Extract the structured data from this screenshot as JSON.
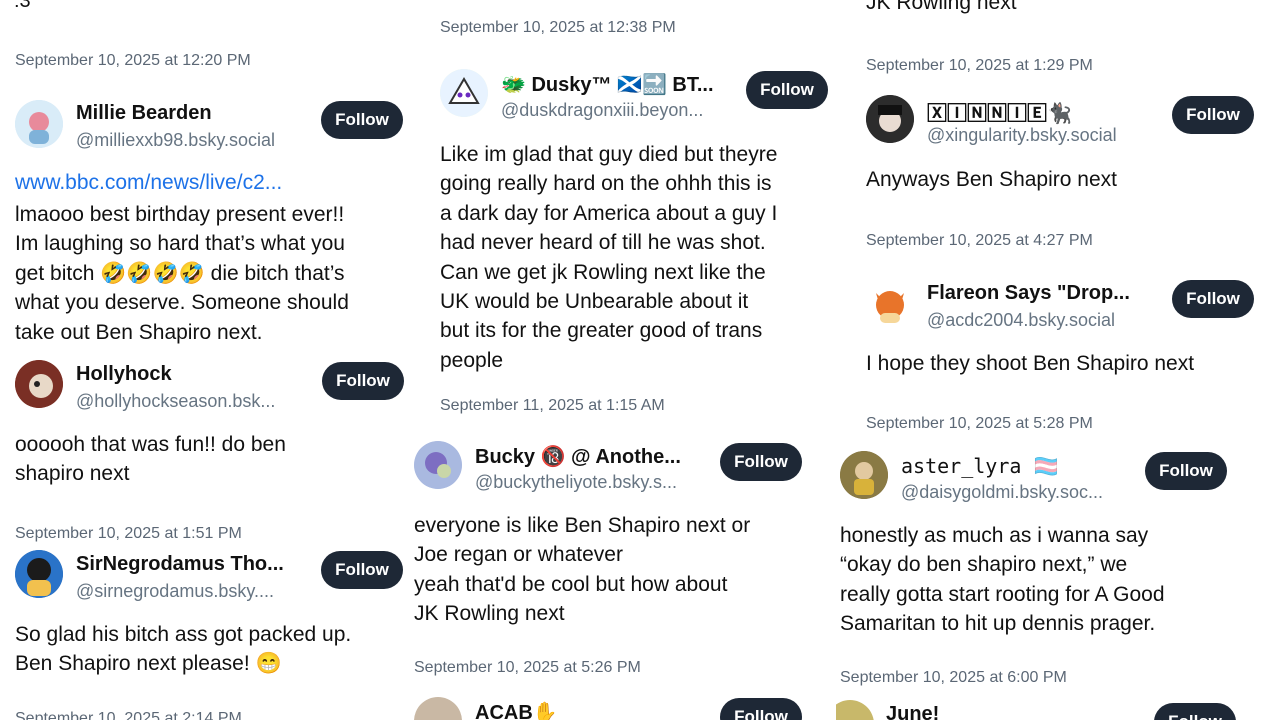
{
  "col1": {
    "top_fragment": ":3",
    "posts": [
      {
        "timestamp": "September 10, 2025 at 12:20 PM",
        "name": "Millie Bearden",
        "handle": "@milliexxb98.bsky.social",
        "link": "www.bbc.com/news/live/c2...",
        "body": "lmaooo best birthday present ever!!\nIm laughing so hard that’s what you\nget bitch 🤣🤣🤣🤣 die bitch that’s\nwhat you deserve. Someone should\ntake out Ben Shapiro next."
      },
      {
        "name": "Hollyhock",
        "handle": "@hollyhockseason.bsk...",
        "body": "oooooh that was fun!! do ben\nshapiro next"
      },
      {
        "timestamp": "September 10, 2025 at 1:51 PM",
        "name": "SirNegrodamus Tho...",
        "handle": "@sirnegrodamus.bsky....",
        "body": "So glad his bitch ass got packed up.\nBen Shapiro next please! 😁"
      },
      {
        "timestamp": "September 10, 2025 at 2:14 PM"
      }
    ]
  },
  "col2": {
    "posts": [
      {
        "timestamp": "September 10, 2025 at 12:38 PM",
        "name": "🐲 Dusky™ 🏴󠁧󠁢󠁳󠁣󠁴󠁿🔜 BT...",
        "handle": "@duskdragonxiii.beyon...",
        "body": "Like im glad that guy died but theyre\ngoing really hard on the ohhh this is\na dark day for America about a guy I\nhad never heard of till he was shot.\nCan we get jk Rowling next like the\nUK would be Unbearable about it\nbut its for the greater good of trans\npeople"
      },
      {
        "timestamp": "September 11, 2025 at 1:15 AM",
        "name": "Bucky 🔞 @ Anothe...",
        "handle": "@buckytheliyote.bsky.s...",
        "body": "everyone is like Ben Shapiro next or\nJoe regan or whatever\nyeah that'd be cool but how about\nJK Rowling next"
      },
      {
        "timestamp": "September 10, 2025 at 5:26 PM",
        "name": "ACAB✋"
      }
    ]
  },
  "col3": {
    "top_fragment": "JK Rowling next",
    "posts": [
      {
        "timestamp": "September 10, 2025 at 1:29 PM",
        "name": "🅇🄸🄽🄽🄸🄴🐈‍⬛",
        "handle": "@xingularity.bsky.social",
        "body": "Anyways Ben Shapiro next"
      },
      {
        "timestamp": "September 10, 2025 at 4:27 PM",
        "name": "Flareon Says \"Drop...",
        "handle": "@acdc2004.bsky.social",
        "body": "I hope they shoot Ben Shapiro next"
      },
      {
        "timestamp": "September 10, 2025 at 5:28 PM",
        "name": "aster_lyra 🏳️‍⚧️",
        "handle": "@daisygoldmi.bsky.soc...",
        "body": "honestly as much as i wanna say\n“okay do ben shapiro next,” we\nreally gotta start rooting for A Good\nSamaritan to hit up dennis prager."
      },
      {
        "timestamp": "September 10, 2025 at 6:00 PM",
        "name": "June!"
      }
    ]
  },
  "follow_label": "Follow",
  "colors": {
    "follow_bg": "#1e2836",
    "link": "#1d72e8",
    "timestamp": "#5b6775"
  }
}
